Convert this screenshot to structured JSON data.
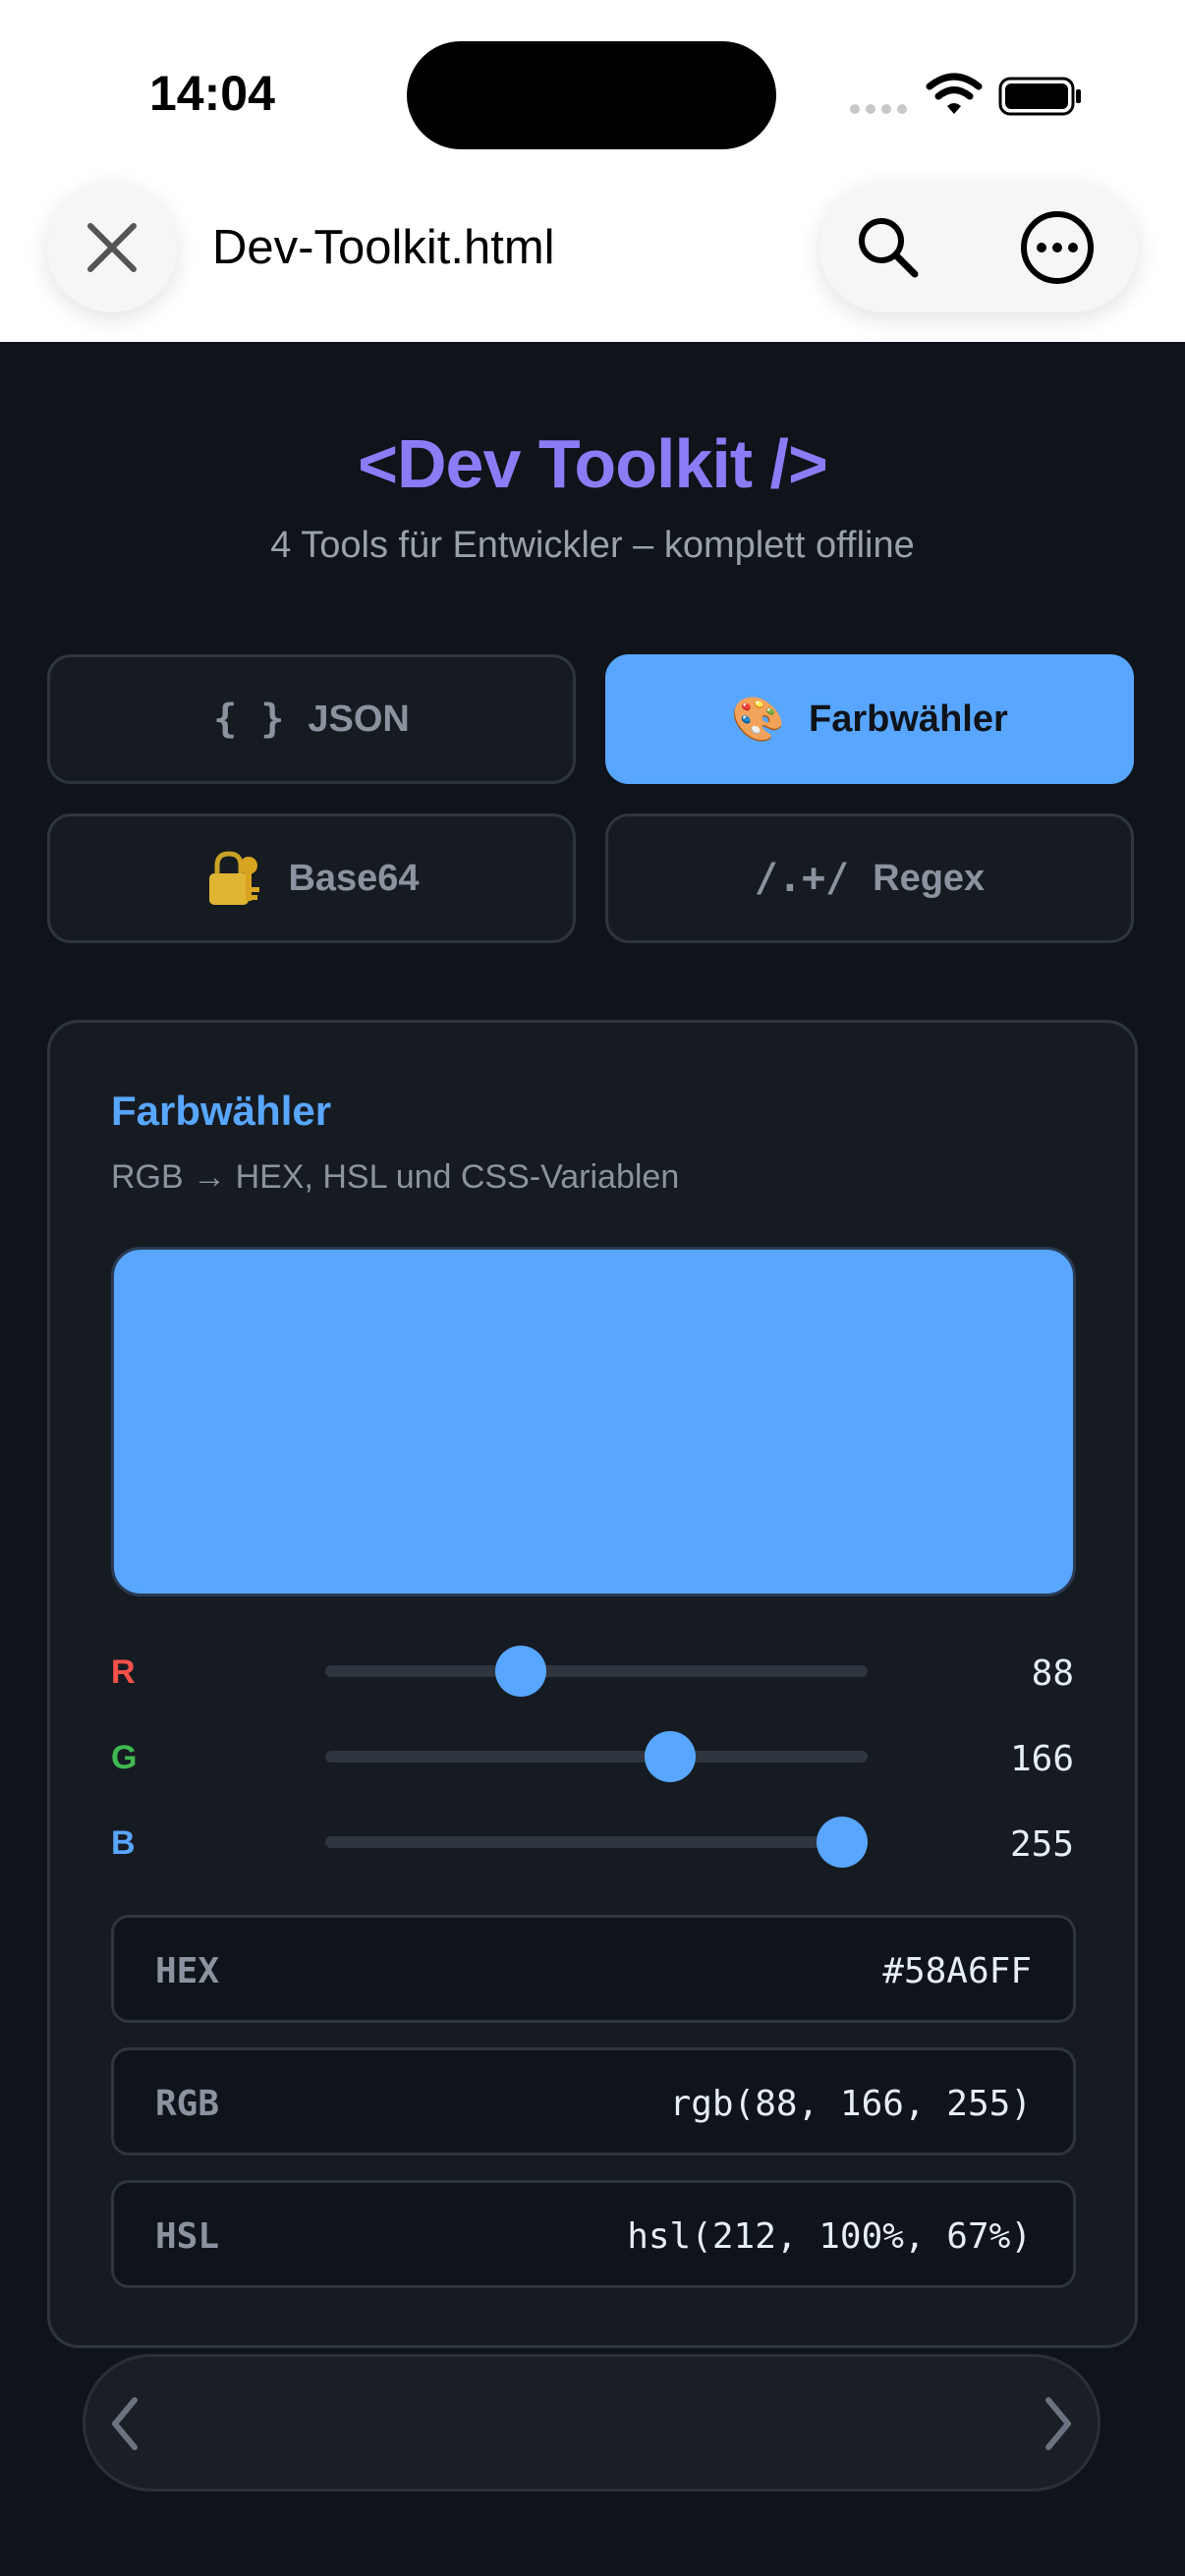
{
  "status_bar": {
    "time": "14:04"
  },
  "browser": {
    "page_title": "Dev-Toolkit.html",
    "close_icon": "close-icon",
    "search_icon": "search-icon",
    "more_icon": "more-icon"
  },
  "header": {
    "title": "<Dev Toolkit />",
    "subtitle": "4 Tools für Entwickler – komplett offline"
  },
  "tabs": [
    {
      "icon": "{ }",
      "label": "JSON",
      "active": false
    },
    {
      "icon": "🎨",
      "label": "Farbwähler",
      "active": true
    },
    {
      "icon": "🔐",
      "label": "Base64",
      "active": false
    },
    {
      "icon": "/.+/",
      "label": "Regex",
      "active": false
    }
  ],
  "color_picker": {
    "title": "Farbwähler",
    "subtitle": "RGB → HEX, HSL und CSS-Variablen",
    "swatch_color": "#58A6FF",
    "channels": [
      {
        "label": "R",
        "value": "88",
        "color": "#f85149"
      },
      {
        "label": "G",
        "value": "166",
        "color": "#3fb950"
      },
      {
        "label": "B",
        "value": "255",
        "color": "#58a6ff"
      }
    ],
    "outputs": [
      {
        "key": "HEX",
        "value": "#58A6FF"
      },
      {
        "key": "RGB",
        "value": "rgb(88, 166, 255)"
      },
      {
        "key": "HSL",
        "value": "hsl(212, 100%, 67%)"
      }
    ]
  },
  "colors": {
    "accent": "#58a6ff",
    "title_purple": "#8b7cf6",
    "background": "#0f131a"
  }
}
